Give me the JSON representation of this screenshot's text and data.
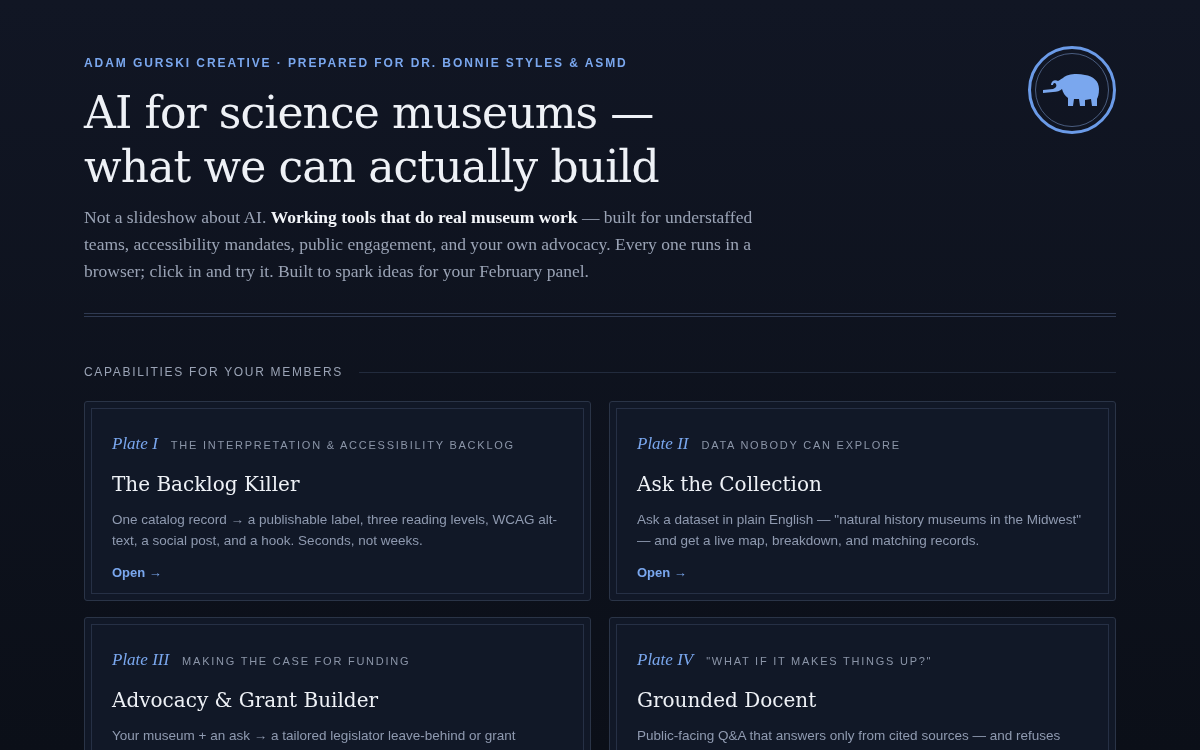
{
  "eyebrow": "ADAM GURSKI CREATIVE · PREPARED FOR DR. BONNIE STYLES & ASMD",
  "title_lines": [
    "AI for science museums —",
    "what we can actually build"
  ],
  "intro": "Not a slideshow about AI. **Working tools that do real museum work** — built for understaffed teams, accessibility mandates, public engagement, and your own advocacy. Every one runs in a browser; click in and try it. Built to spark ideas for your February panel.",
  "section_label": "CAPABILITIES FOR YOUR MEMBERS",
  "cards": [
    {
      "plate": "Plate I",
      "category": "THE INTERPRETATION & ACCESSIBILITY BACKLOG",
      "title": "The Backlog Killer",
      "description": "One catalog record → a publishable label, three reading levels, WCAG alt-text, a social post, and a hook. Seconds, not weeks.",
      "link": "Open →"
    },
    {
      "plate": "Plate II",
      "category": "DATA NOBODY CAN EXPLORE",
      "title": "Ask the Collection",
      "description": "Ask a dataset in plain English — \"natural history museums in the Midwest\" — and get a live map, breakdown, and matching records.",
      "link": "Open →"
    },
    {
      "plate": "Plate III",
      "category": "MAKING THE CASE FOR FUNDING",
      "title": "Advocacy & Grant Builder",
      "description": "Your museum + an ask → a tailored legislator leave-behind or grant"
    },
    {
      "plate": "Plate IV",
      "category": "\"WHAT IF IT MAKES THINGS UP?\"",
      "title": "Grounded Docent",
      "description": "Public-facing Q&A that answers only from cited sources — and refuses"
    }
  ]
}
